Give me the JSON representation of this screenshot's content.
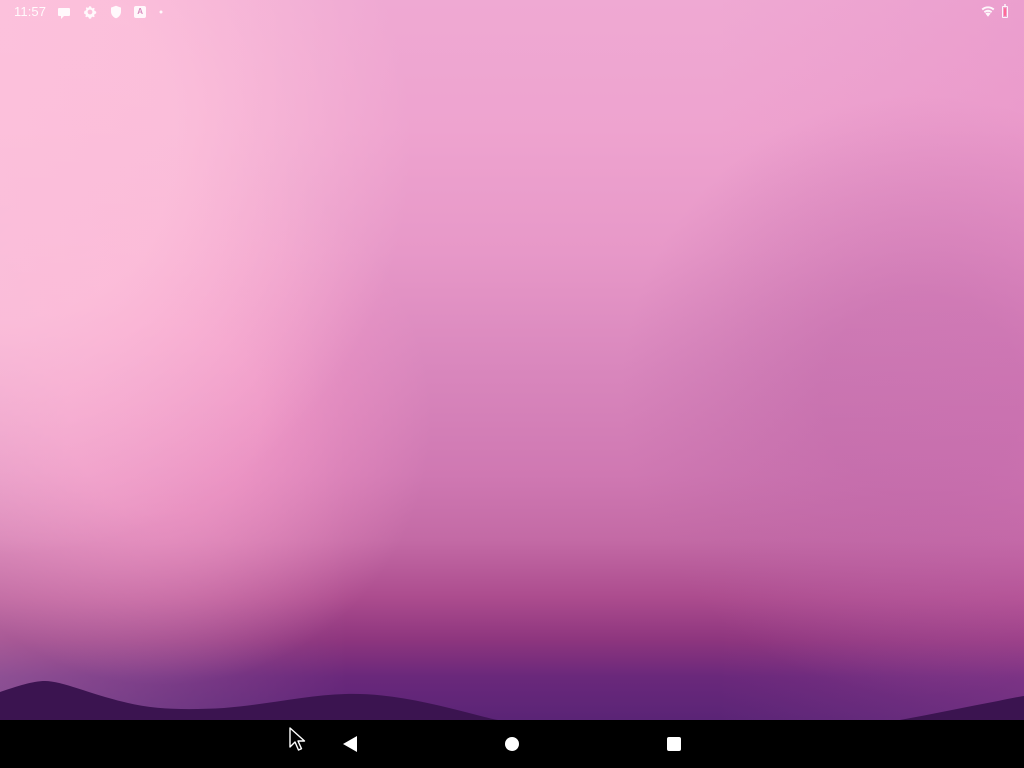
{
  "status_bar": {
    "time": "11:57",
    "left_icons": [
      "notification-icon",
      "gear-icon",
      "shield-icon",
      "a-badge-icon",
      "dot-icon"
    ],
    "right_icons": [
      "wifi-icon",
      "battery-icon"
    ],
    "a_badge": "A"
  },
  "wallpaper": {
    "colors": {
      "top": "#efa9d3",
      "middle": "#d987bd",
      "lower": "#ac4c8e",
      "bottom": "#5a2476",
      "mountains": "#3b1450"
    }
  },
  "navigation_bar": {
    "buttons": [
      "back-icon",
      "home-icon",
      "recents-icon"
    ]
  },
  "cursor": {
    "icon": "mouse-pointer-icon"
  }
}
